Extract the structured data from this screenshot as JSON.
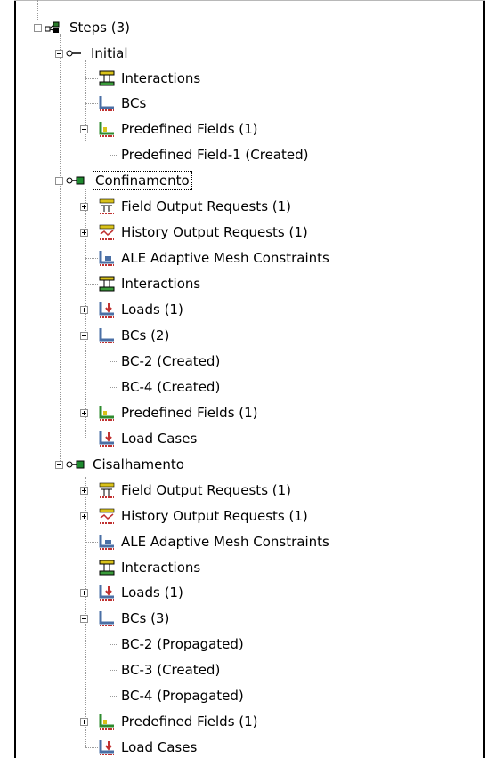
{
  "tree": {
    "steps": "Steps (3)",
    "initial": {
      "label": "Initial",
      "interactions": "Interactions",
      "bcs": "BCs",
      "predefined": "Predefined Fields (1)",
      "pf1": "Predefined Field-1 (Created)"
    },
    "confinamento": {
      "label": "Confinamento",
      "field_output": "Field Output Requests (1)",
      "history_output": "History Output Requests (1)",
      "ale": "ALE Adaptive Mesh Constraints",
      "interactions": "Interactions",
      "loads": "Loads (1)",
      "bcs": "BCs (2)",
      "bc2": "BC-2 (Created)",
      "bc4": "BC-4 (Created)",
      "predefined": "Predefined Fields (1)",
      "load_cases": "Load Cases"
    },
    "cisalhamento": {
      "label": "Cisalhamento",
      "field_output": "Field Output Requests (1)",
      "history_output": "History Output Requests (1)",
      "ale": "ALE Adaptive Mesh Constraints",
      "interactions": "Interactions",
      "loads": "Loads (1)",
      "bcs": "BCs (3)",
      "bc2": "BC-2 (Propagated)",
      "bc3": "BC-3 (Created)",
      "bc4": "BC-4 (Propagated)",
      "predefined": "Predefined Fields (1)",
      "load_cases": "Load Cases"
    }
  },
  "colors": {
    "selected_border": "#000000",
    "expander_border": "#909090",
    "connector": "#9a9a9a"
  }
}
